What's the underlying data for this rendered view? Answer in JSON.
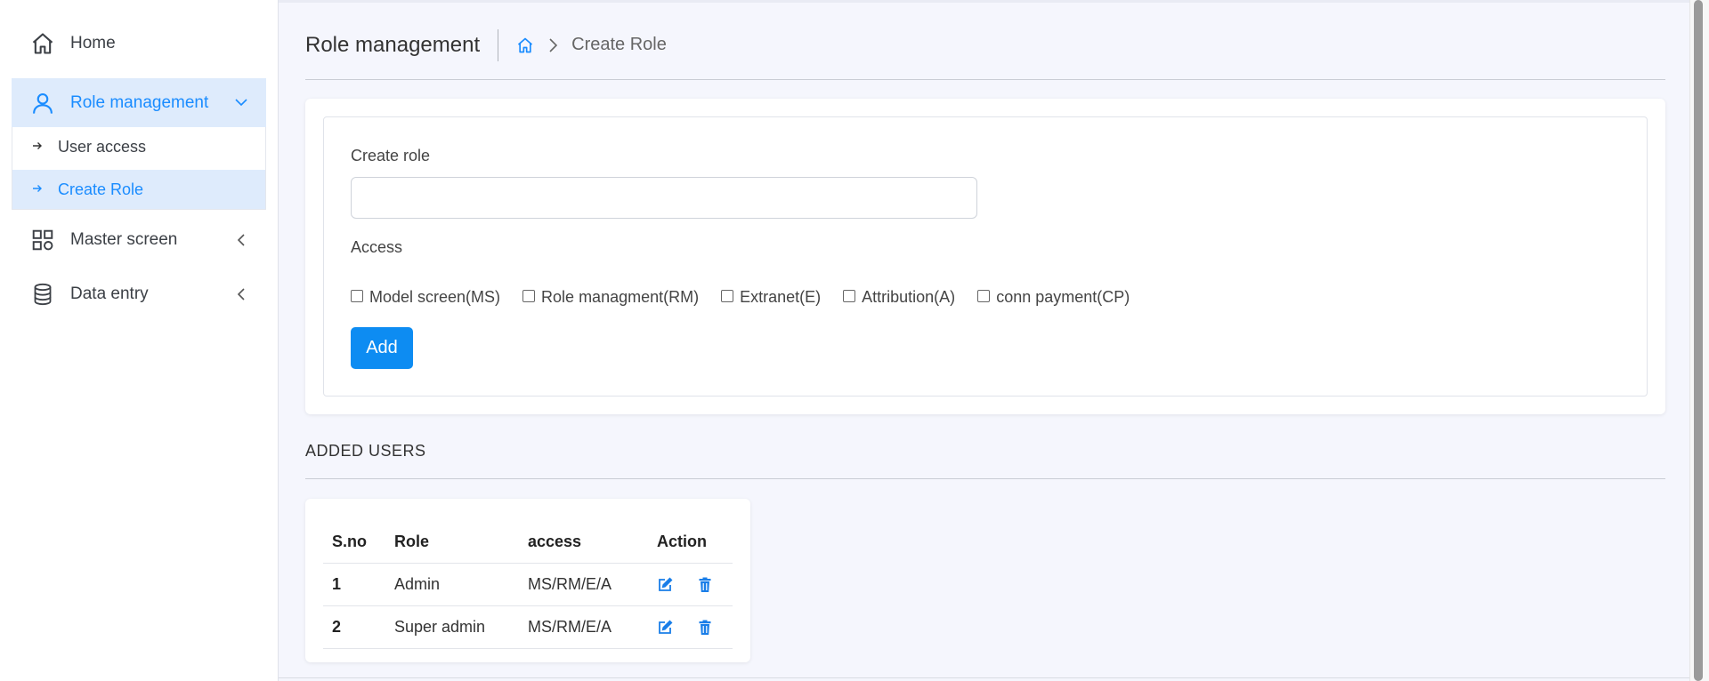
{
  "sidebar": {
    "home": "Home",
    "role_management": "Role management",
    "sub": [
      "User access",
      "Create Role"
    ],
    "master_screen": "Master screen",
    "data_entry": "Data entry"
  },
  "header": {
    "title": "Role management",
    "breadcrumb_current": "Create Role"
  },
  "form": {
    "create_role_label": "Create role",
    "create_role_value": "",
    "access_label": "Access",
    "checkboxes": [
      "Model screen(MS)",
      "Role managment(RM)",
      "Extranet(E)",
      "Attribution(A)",
      "conn payment(CP)"
    ],
    "add_button": "Add"
  },
  "added_users": {
    "title": "ADDED USERS",
    "columns": [
      "S.no",
      "Role",
      "access",
      "Action"
    ],
    "rows": [
      {
        "sno": "1",
        "role": "Admin",
        "access": "MS/RM/E/A"
      },
      {
        "sno": "2",
        "role": "Super admin",
        "access": "MS/RM/E/A"
      }
    ]
  },
  "colors": {
    "accent": "#1a8cff",
    "active_bg": "#deebfc",
    "button": "#0d8cf2",
    "page_bg": "#f5f6fd"
  }
}
